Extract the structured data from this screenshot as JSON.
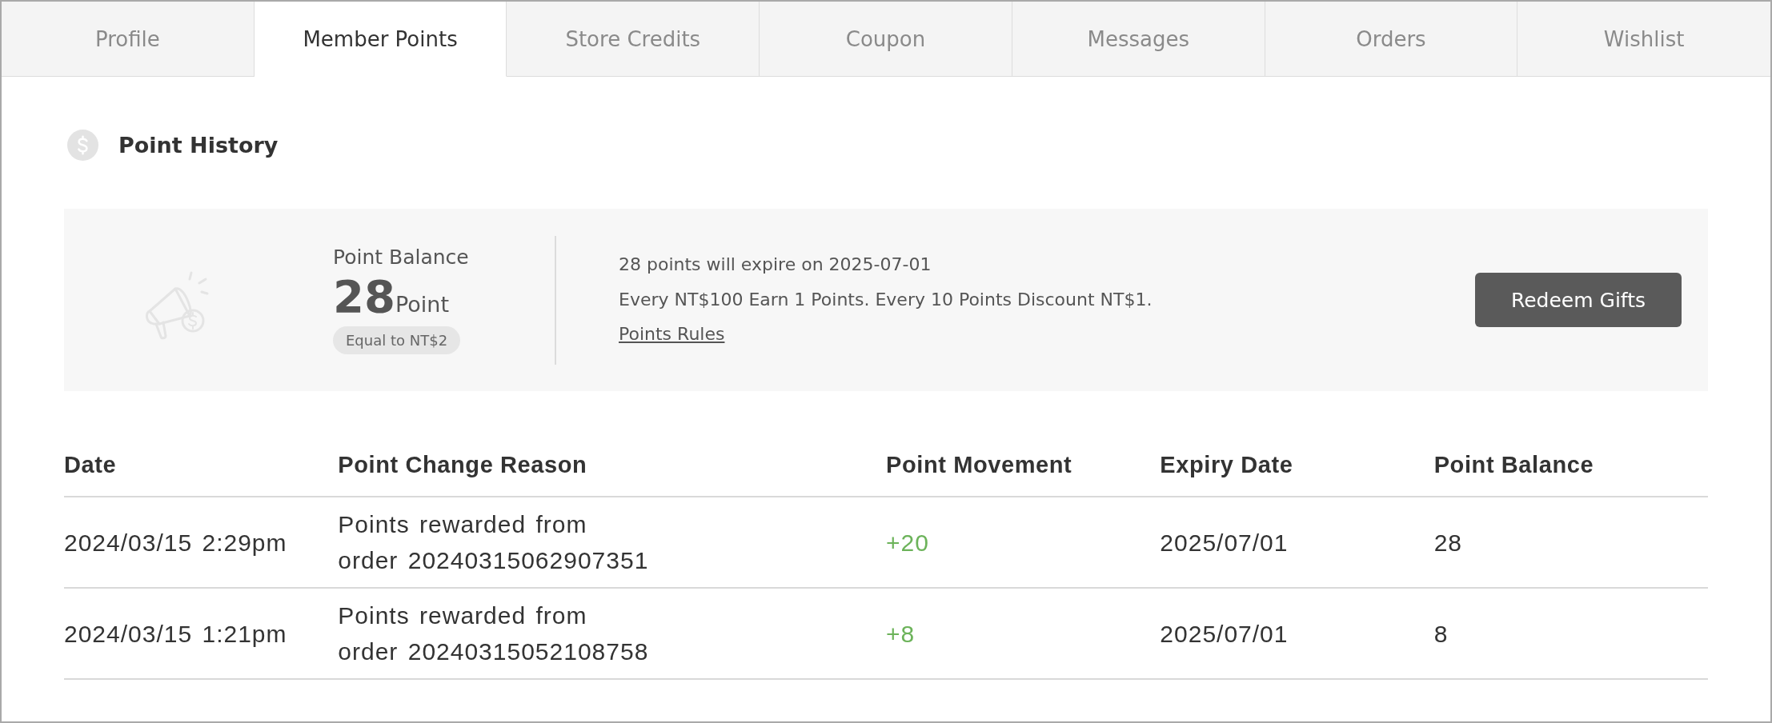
{
  "tabs": [
    {
      "label": "Profile",
      "selected": false
    },
    {
      "label": "Member Points",
      "selected": true
    },
    {
      "label": "Store Credits",
      "selected": false
    },
    {
      "label": "Coupon",
      "selected": false
    },
    {
      "label": "Messages",
      "selected": false
    },
    {
      "label": "Orders",
      "selected": false
    },
    {
      "label": "Wishlist",
      "selected": false
    }
  ],
  "section": {
    "title": "Point History"
  },
  "balance_card": {
    "label": "Point Balance",
    "points": "28",
    "unit": "Point",
    "equivalent": "Equal to NT$2",
    "notes": [
      "28 points will expire on 2025-07-01",
      "Every NT$100 Earn 1 Points. Every 10 Points Discount NT$1."
    ],
    "rules_link": "Points Rules",
    "redeem_button": "Redeem Gifts"
  },
  "table": {
    "columns": [
      "Date",
      "Point Change Reason",
      "Point Movement",
      "Expiry Date",
      "Point Balance"
    ],
    "rows": [
      {
        "date": "2024/03/15 2:29pm",
        "reason": "Points rewarded from order 20240315062907351",
        "movement": "+20",
        "expiry": "2025/07/01",
        "balance": "28"
      },
      {
        "date": "2024/03/15 1:21pm",
        "reason": "Points rewarded from order 20240315052108758",
        "movement": "+8",
        "expiry": "2025/07/01",
        "balance": "8"
      }
    ]
  }
}
